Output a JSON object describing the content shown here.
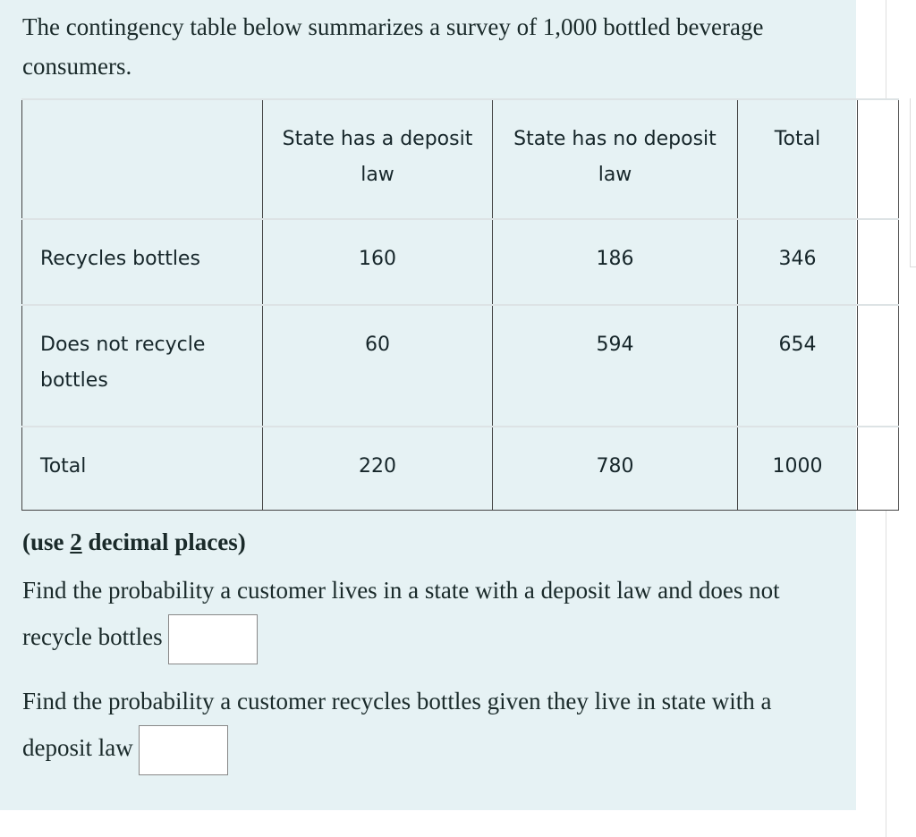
{
  "intro": "The contingency table below summarizes a survey of 1,000 bottled beverage consumers.",
  "table": {
    "headers": [
      "",
      "State has a deposit law",
      "State has no deposit law",
      "Total"
    ],
    "rows": [
      {
        "label": "Recycles bottles",
        "values": [
          "160",
          "186",
          "346"
        ]
      },
      {
        "label": "Does not recycle bottles",
        "values": [
          "60",
          "594",
          "654"
        ]
      },
      {
        "label": "Total",
        "values": [
          "220",
          "780",
          "1000"
        ]
      }
    ]
  },
  "hint": {
    "prefix": "(use ",
    "number": "2",
    "suffix": " decimal places)"
  },
  "questions": [
    {
      "text": "Find the probability a customer lives in a state with a deposit law and does not recycle bottles",
      "answer_value": ""
    },
    {
      "text": "Find the probability a customer recycles bottles given they live in state with a deposit law",
      "answer_value": ""
    }
  ],
  "colors": {
    "panel_background": "#e6f2f4",
    "text": "#1a2a2a"
  }
}
